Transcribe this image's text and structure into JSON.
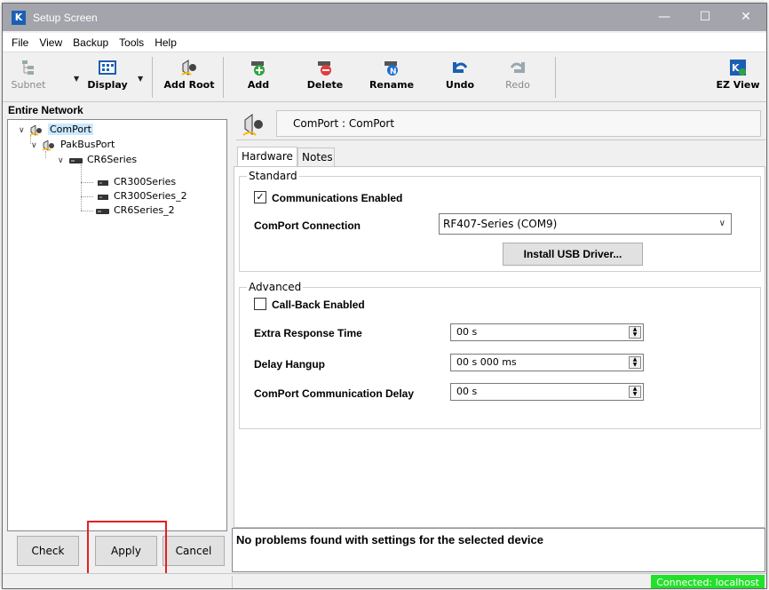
{
  "window": {
    "title": "Setup Screen",
    "app_icon": "K",
    "controls": {
      "minimize": "—",
      "maximize": "☐",
      "close": "✕"
    }
  },
  "menu": [
    "File",
    "View",
    "Backup",
    "Tools",
    "Help"
  ],
  "toolbar": {
    "subnet": "Subnet",
    "display": "Display",
    "add_root": "Add Root",
    "add": "Add",
    "delete": "Delete",
    "rename": "Rename",
    "undo": "Undo",
    "redo": "Redo",
    "ez_view": "EZ View"
  },
  "network": {
    "header": "Entire Network",
    "tree": [
      {
        "label": "ComPort",
        "level": 0,
        "expanded": true,
        "selected": true,
        "icon": "comport-icon"
      },
      {
        "label": "PakBusPort",
        "level": 1,
        "expanded": true,
        "icon": "pakbusport-icon"
      },
      {
        "label": "CR6Series",
        "level": 2,
        "expanded": true,
        "icon": "datalogger-icon"
      },
      {
        "label": "CR300Series",
        "level": 3,
        "icon": "datalogger-small-icon"
      },
      {
        "label": "CR300Series_2",
        "level": 3,
        "icon": "datalogger-small-icon"
      },
      {
        "label": "CR6Series_2",
        "level": 2,
        "icon": "datalogger-icon"
      }
    ]
  },
  "left_buttons": {
    "check": "Check",
    "apply": "Apply",
    "cancel": "Cancel"
  },
  "device": {
    "title": "ComPort : ComPort"
  },
  "tabs": [
    "Hardware",
    "Notes"
  ],
  "standard": {
    "group_label": "Standard",
    "comm_enabled_label": "Communications Enabled",
    "comm_enabled": true,
    "connection_label": "ComPort Connection",
    "connection_value": "RF407-Series (COM9)",
    "install_usb": "Install USB Driver..."
  },
  "advanced": {
    "group_label": "Advanced",
    "callback_label": "Call-Back Enabled",
    "callback_enabled": false,
    "extra_response_label": "Extra Response Time",
    "extra_response_value": "00 s",
    "delay_hangup_label": "Delay Hangup",
    "delay_hangup_value": "00 s 000 ms",
    "comm_delay_label": "ComPort Communication Delay",
    "comm_delay_value": "00 s"
  },
  "messages": {
    "text": "No problems found with settings for the selected device"
  },
  "status": {
    "connection": "Connected: localhost"
  },
  "colors": {
    "accent": "#1b5fb5",
    "status_ok": "#23e02a",
    "highlight": "#e32020",
    "selection": "#cce8ff"
  }
}
